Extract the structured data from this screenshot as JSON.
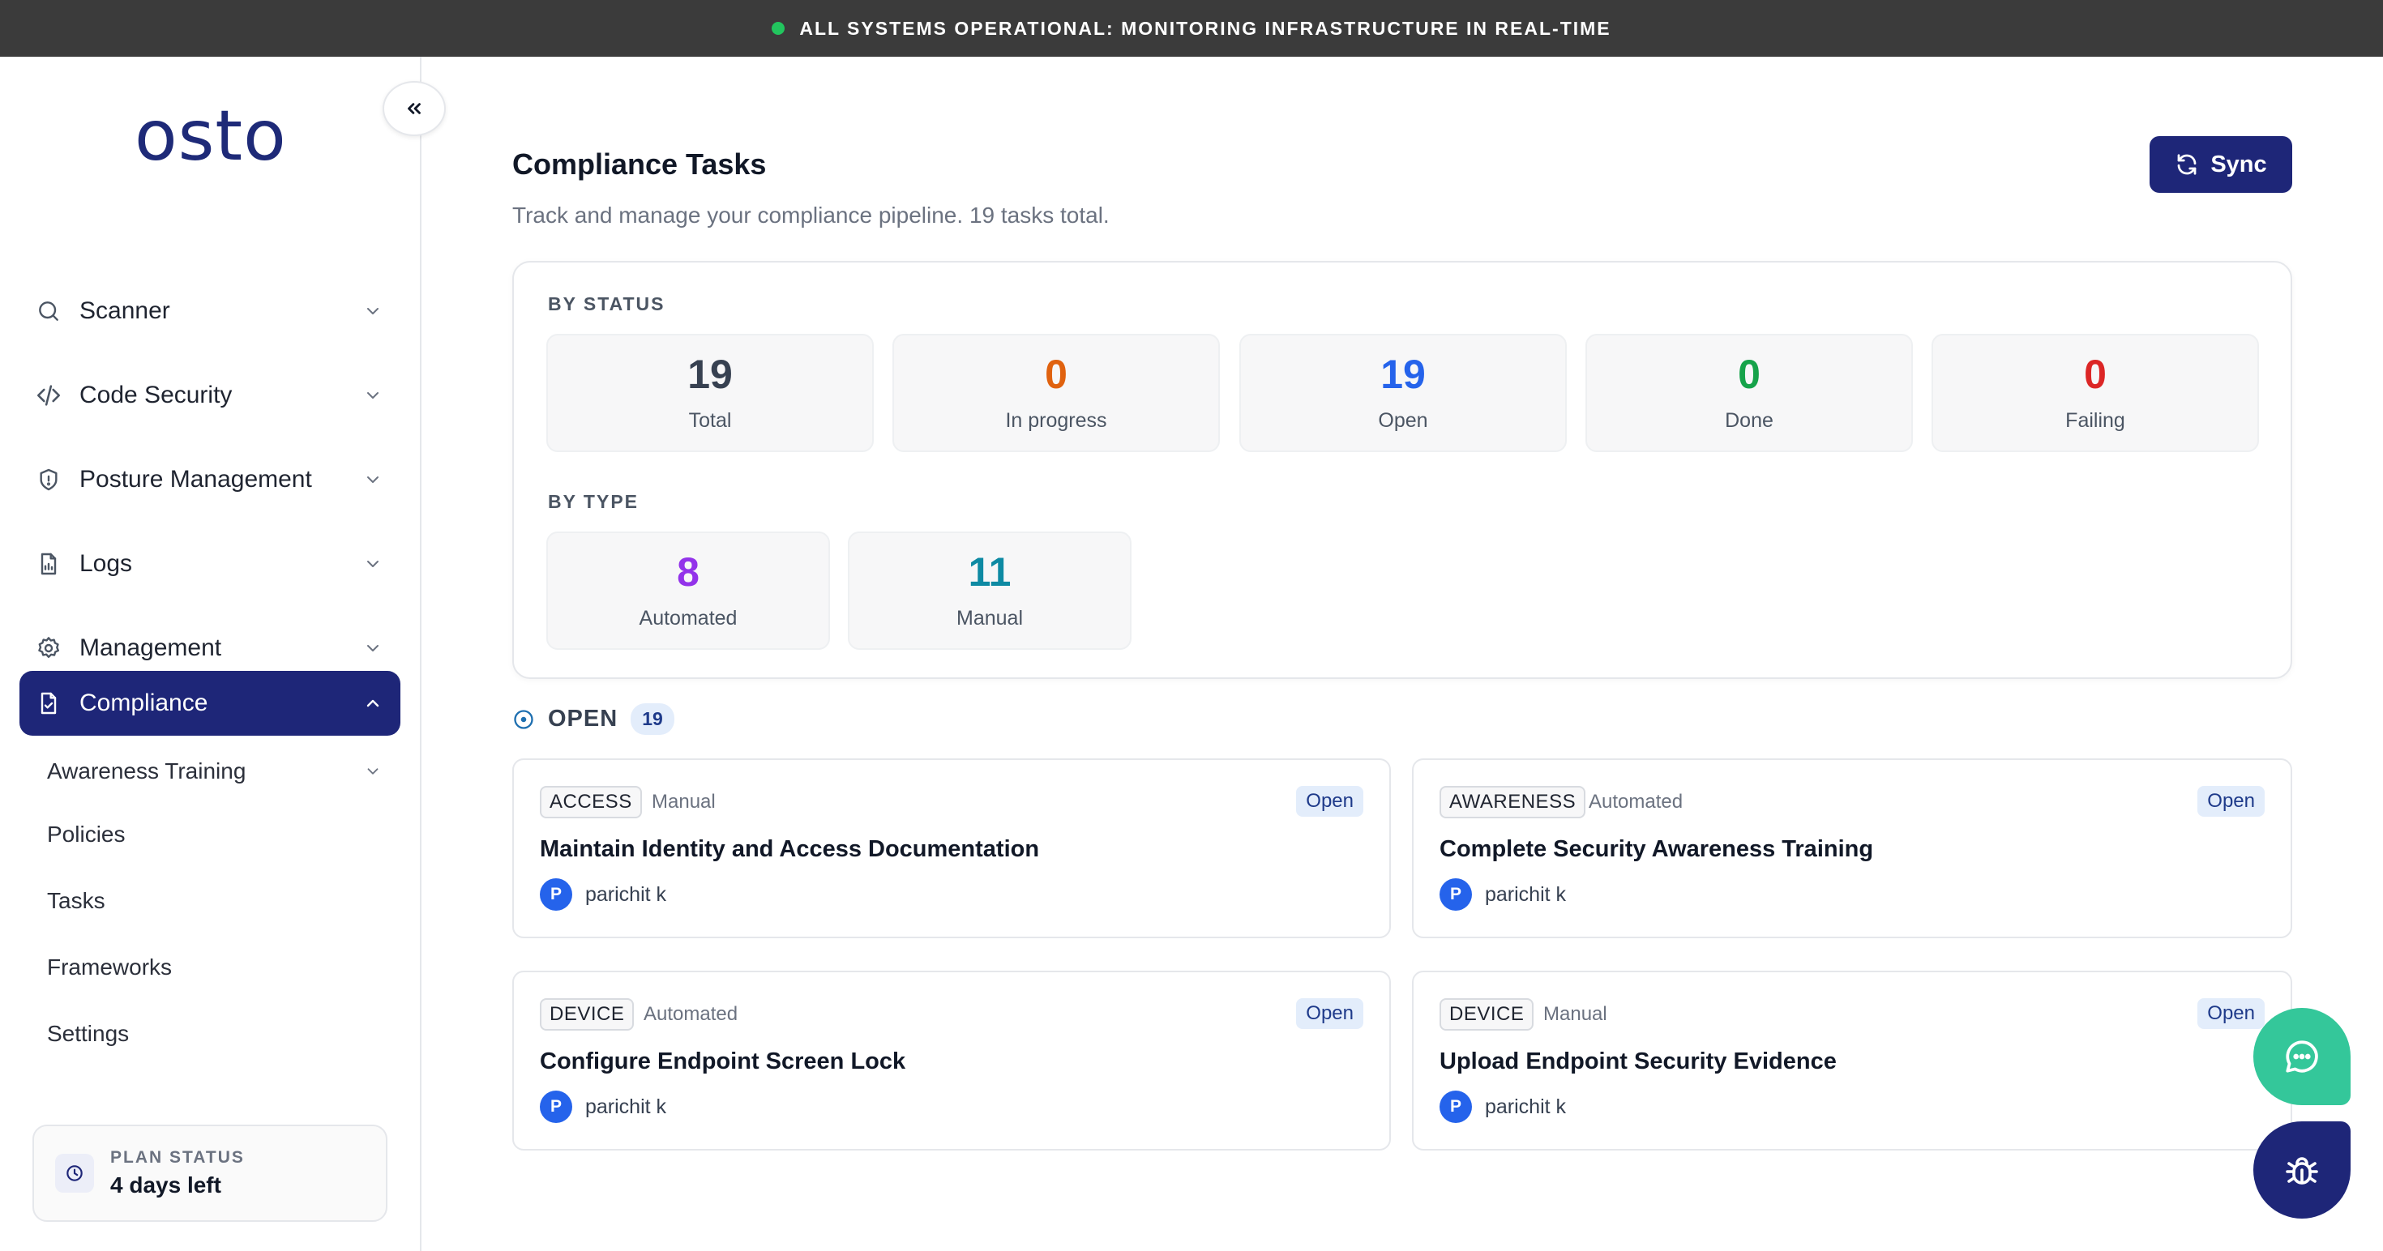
{
  "banner": {
    "text": "ALL SYSTEMS OPERATIONAL: MONITORING INFRASTRUCTURE IN REAL-TIME",
    "status_color": "#22c55e"
  },
  "sidebar": {
    "logo": "osto",
    "nav": [
      {
        "label": "Scanner",
        "icon": "search-icon"
      },
      {
        "label": "Code Security",
        "icon": "code-icon"
      },
      {
        "label": "Posture Management",
        "icon": "shield-icon"
      },
      {
        "label": "Logs",
        "icon": "document-icon"
      },
      {
        "label": "Management",
        "icon": "gear-icon"
      },
      {
        "label": "Compliance",
        "icon": "compliance-icon",
        "active": true
      }
    ],
    "sub": [
      {
        "label": "Awareness Training"
      },
      {
        "label": "Policies"
      },
      {
        "label": "Tasks"
      },
      {
        "label": "Frameworks"
      },
      {
        "label": "Settings"
      }
    ],
    "plan": {
      "label": "PLAN STATUS",
      "value": "4 days left"
    }
  },
  "page": {
    "title": "Compliance Tasks",
    "subtitle": "Track and manage your compliance pipeline. 19 tasks total.",
    "sync_label": "Sync"
  },
  "summary": {
    "by_status_label": "BY STATUS",
    "status": [
      {
        "value": "19",
        "label": "Total",
        "color": "#374151"
      },
      {
        "value": "0",
        "label": "In progress",
        "color": "#e0620f"
      },
      {
        "value": "19",
        "label": "Open",
        "color": "#2563eb"
      },
      {
        "value": "0",
        "label": "Done",
        "color": "#16a34a"
      },
      {
        "value": "0",
        "label": "Failing",
        "color": "#dc2626"
      }
    ],
    "by_type_label": "BY TYPE",
    "types": [
      {
        "value": "8",
        "label": "Automated",
        "color": "#9333ea"
      },
      {
        "value": "11",
        "label": "Manual",
        "color": "#0e8aa3"
      }
    ]
  },
  "group": {
    "label": "OPEN",
    "count": "19"
  },
  "tasks": [
    {
      "tag": "ACCESS",
      "kind": "Manual",
      "status": "Open",
      "title": "Maintain Identity and Access Documentation",
      "user_initial": "P",
      "user": "parichit k"
    },
    {
      "tag": "AWARENESS",
      "kind": "Automated",
      "status": "Open",
      "title": "Complete Security Awareness Training",
      "user_initial": "P",
      "user": "parichit k"
    },
    {
      "tag": "DEVICE",
      "kind": "Automated",
      "status": "Open",
      "title": "Configure Endpoint Screen Lock",
      "user_initial": "P",
      "user": "parichit k"
    },
    {
      "tag": "DEVICE",
      "kind": "Manual",
      "status": "Open",
      "title": "Upload Endpoint Security Evidence",
      "user_initial": "P",
      "user": "parichit k"
    }
  ],
  "fabs": {
    "chat_icon": "chat-icon",
    "bug_icon": "bug-icon"
  }
}
